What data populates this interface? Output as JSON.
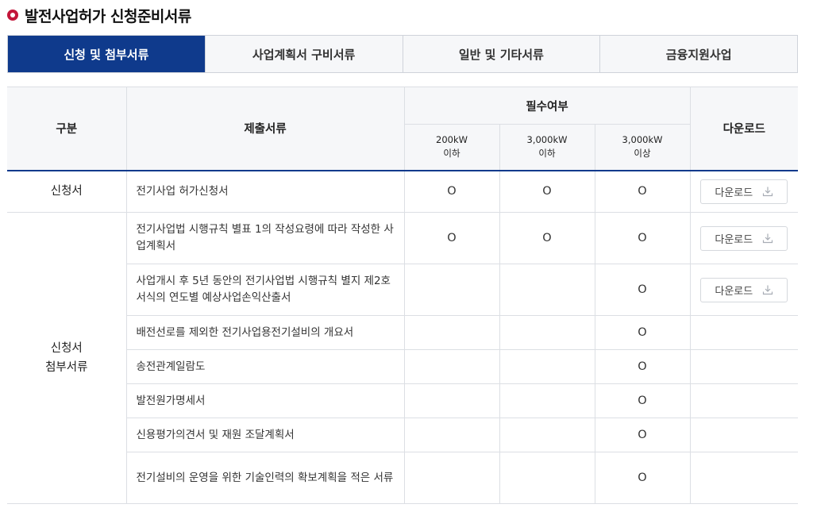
{
  "page": {
    "title": "발전사업허가 신청준비서류"
  },
  "tabs": [
    {
      "label": "신청 및 첨부서류",
      "active": true
    },
    {
      "label": "사업계획서 구비서류",
      "active": false
    },
    {
      "label": "일반 및 기타서류",
      "active": false
    },
    {
      "label": "금융지원사업",
      "active": false
    }
  ],
  "table": {
    "headers": {
      "category": "구분",
      "document": "제출서류",
      "required": "필수여부",
      "download": "다운로드",
      "capacity": [
        {
          "value": "200kW",
          "note": "이하"
        },
        {
          "value": "3,000kW",
          "note": "이하"
        },
        {
          "value": "3,000kW",
          "note": "이상"
        }
      ]
    },
    "groups": [
      {
        "category_lines": [
          "신청서"
        ],
        "rows": [
          {
            "document": "전기사업 허가신청서",
            "marks": [
              "O",
              "O",
              "O"
            ],
            "download": "다운로드"
          }
        ]
      },
      {
        "category_lines": [
          "신청서",
          "첨부서류"
        ],
        "rows": [
          {
            "document": "전기사업법 시행규칙 별표 1의 작성요령에 따라 작성한 사업계획서",
            "marks": [
              "O",
              "O",
              "O"
            ],
            "download": "다운로드"
          },
          {
            "document": "사업개시 후 5년 동안의 전기사업법 시행규칙 별지 제2호 서식의 연도별 예상사업손익산출서",
            "marks": [
              "",
              "",
              "O"
            ],
            "download": "다운로드"
          },
          {
            "document": "배전선로를 제외한 전기사업용전기설비의 개요서",
            "marks": [
              "",
              "",
              "O"
            ],
            "download": ""
          },
          {
            "document": "송전관계일람도",
            "marks": [
              "",
              "",
              "O"
            ],
            "download": ""
          },
          {
            "document": "발전원가명세서",
            "marks": [
              "",
              "",
              "O"
            ],
            "download": ""
          },
          {
            "document": "신용평가의견서 및 재원 조달계획서",
            "marks": [
              "",
              "",
              "O"
            ],
            "download": ""
          },
          {
            "document": "전기설비의 운영을 위한 기술인력의 확보계획을 적은 서류",
            "marks": [
              "",
              "",
              "O"
            ],
            "download": ""
          }
        ]
      }
    ]
  },
  "icons": {
    "download": "download-icon"
  },
  "colors": {
    "accent": "#0f3a8c",
    "title_dot": "#c3163a"
  }
}
